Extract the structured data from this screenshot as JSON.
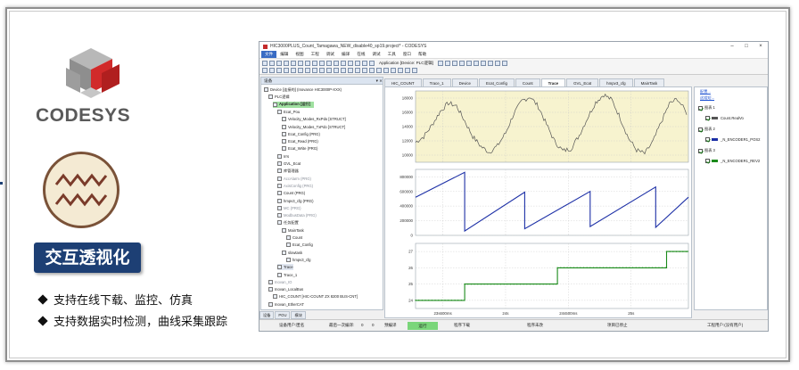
{
  "promo": {
    "logo_text": "CODESYS",
    "title": "交互透视化",
    "bullets": [
      "支持在线下载、监控、仿真",
      "支持数据实时检测，曲线采集跟踪"
    ],
    "colors": {
      "badge": "#1d3f74",
      "cube_red": "#d12a2a",
      "cube_gray": "#9a9a9a",
      "circle_fill": "#f4ead3",
      "zigzag": "#7a3b2a"
    }
  },
  "window": {
    "title": "HIC3000PLUS_Count_Tamagawa_NEW_disable40_sp19.project* - CODESYS",
    "controls": [
      "–",
      "□",
      "×"
    ],
    "menu": [
      "文件",
      "编辑",
      "视图",
      "工程",
      "调试",
      "编译",
      "在线",
      "调试",
      "工具",
      "窗口",
      "帮助"
    ],
    "toolbar_application": "Application [Device: PLC逻辑]"
  },
  "device_panel": {
    "title": "设备",
    "pin": "▾ ⨯",
    "items": [
      {
        "label": "Device [连接的] (Inovance HIC3000P-XXX)",
        "indent": 0,
        "style": "normal"
      },
      {
        "label": "PLC逻辑",
        "indent": 1,
        "style": "normal"
      },
      {
        "label": "Application [运行]",
        "indent": 2,
        "style": "sel"
      },
      {
        "label": "Ecat_Pou",
        "indent": 3,
        "style": "normal"
      },
      {
        "label": "Velocity_Modes_RxPdo [STRUCT]",
        "indent": 4,
        "style": "normal"
      },
      {
        "label": "Velocity_Modes_TxPdo [STRUCT]",
        "indent": 4,
        "style": "normal"
      },
      {
        "label": "Ecat_Config (PRG)",
        "indent": 4,
        "style": "normal"
      },
      {
        "label": "Ecat_Read (PRG)",
        "indent": 4,
        "style": "normal"
      },
      {
        "label": "Ecat_Write (PRG)",
        "indent": 4,
        "style": "normal"
      },
      {
        "label": "Irrs",
        "indent": 3,
        "style": "normal"
      },
      {
        "label": "GVL_Ecat",
        "indent": 3,
        "style": "normal"
      },
      {
        "label": "库管理器",
        "indent": 3,
        "style": "normal"
      },
      {
        "label": "AccAlarm (PRG)",
        "indent": 3,
        "style": "gray"
      },
      {
        "label": "AxisConfig (PRG)",
        "indent": 3,
        "style": "gray"
      },
      {
        "label": "Count (PRG)",
        "indent": 3,
        "style": "normal"
      },
      {
        "label": "hmpv3_cfg (PRG)",
        "indent": 3,
        "style": "normal"
      },
      {
        "label": "MC (PRG)",
        "indent": 3,
        "style": "gray"
      },
      {
        "label": "ModbusData (PRG)",
        "indent": 3,
        "style": "gray"
      },
      {
        "label": "任务配置",
        "indent": 3,
        "style": "normal"
      },
      {
        "label": "MainTask",
        "indent": 4,
        "style": "normal"
      },
      {
        "label": "Count",
        "indent": 5,
        "style": "normal"
      },
      {
        "label": "Ecat_Config",
        "indent": 5,
        "style": "normal"
      },
      {
        "label": "slowtask",
        "indent": 4,
        "style": "normal"
      },
      {
        "label": "hmpv3_cfg",
        "indent": 5,
        "style": "normal"
      },
      {
        "label": "Trace",
        "indent": 3,
        "style": "hl"
      },
      {
        "label": "Trace_1",
        "indent": 3,
        "style": "normal"
      },
      {
        "label": "Inovan_IO",
        "indent": 1,
        "style": "gray"
      },
      {
        "label": "Inovan_LocalBus",
        "indent": 1,
        "style": "normal"
      },
      {
        "label": "HIC_COUNT [HIC-COUNT ZX 8200 BUS-CNT]",
        "indent": 2,
        "style": "normal"
      },
      {
        "label": "Inovan_EtherCAT",
        "indent": 1,
        "style": "normal"
      }
    ]
  },
  "bottom_tabs": [
    "设备",
    "POU",
    "模块"
  ],
  "editor_tabs": [
    {
      "label": "HIC_COUNT",
      "active": false
    },
    {
      "label": "Trace_1",
      "active": false
    },
    {
      "label": "Device",
      "active": false
    },
    {
      "label": "Ecat_Config",
      "active": false
    },
    {
      "label": "Count",
      "active": false
    },
    {
      "label": "Trace",
      "active": true
    },
    {
      "label": "GVL_Ecat",
      "active": false
    },
    {
      "label": "hmpv3_cfg",
      "active": false
    },
    {
      "label": "MainTask",
      "active": false
    }
  ],
  "right_panel": {
    "links": [
      "配置...",
      "这组短..."
    ],
    "items": [
      {
        "label": "图表 1",
        "kind": "group"
      },
      {
        "label": "Count.RealVo",
        "kind": "series",
        "color": "#555555"
      },
      {
        "label": "图表 2",
        "kind": "group"
      },
      {
        "label": "_N_ENCODER1_POS2",
        "kind": "series",
        "color": "#1c2fa6"
      },
      {
        "label": "图表 3",
        "kind": "group"
      },
      {
        "label": "_N_ENCODER1_REV2",
        "kind": "series",
        "color": "#1a8a1a"
      }
    ]
  },
  "status": {
    "items": [
      "设备用户:匿名",
      "最后一次编译:",
      "0",
      "0",
      "预编译",
      "运行",
      "程序下载",
      "程序未改",
      "项目已停止",
      "工程用户:(没有用户)"
    ]
  },
  "chart_data": [
    {
      "type": "line",
      "title": "",
      "series": [
        {
          "name": "Count.RealVo",
          "color": "#555555"
        }
      ],
      "ylim": [
        9000,
        19000
      ],
      "y_ticks": [
        10000,
        12000,
        14000,
        16000,
        18000
      ],
      "x": [
        0,
        0.03,
        0.06,
        0.09,
        0.12,
        0.15,
        0.18,
        0.21,
        0.24,
        0.27,
        0.3,
        0.33,
        0.36,
        0.39,
        0.42,
        0.45,
        0.48,
        0.51,
        0.54,
        0.57,
        0.6,
        0.63,
        0.66,
        0.69,
        0.72,
        0.75,
        0.78,
        0.81,
        0.84,
        0.87,
        0.9,
        0.93,
        0.96,
        1.0
      ],
      "values": [
        11800,
        12600,
        14200,
        16100,
        17300,
        16900,
        14800,
        12600,
        11200,
        10400,
        11300,
        13100,
        15800,
        17600,
        18200,
        16800,
        14300,
        11900,
        10600,
        10900,
        12800,
        15200,
        17400,
        18500,
        17700,
        15200,
        12400,
        10700,
        10200,
        11900,
        14600,
        17200,
        17900,
        15500
      ],
      "grid": true,
      "background": "#f7f3cf"
    },
    {
      "type": "line",
      "title": "",
      "series": [
        {
          "name": "_N_ENCODER1_POS2",
          "color": "#1c2fa6"
        }
      ],
      "ylim": [
        0,
        900000
      ],
      "y_ticks": [
        0,
        200000,
        400000,
        600000,
        800000
      ],
      "x": [
        0,
        0.18,
        0.18,
        0.4,
        0.4,
        0.64,
        0.64,
        0.88,
        0.88,
        1.0
      ],
      "values": [
        520000,
        860000,
        60000,
        590000,
        90000,
        600000,
        120000,
        660000,
        110000,
        520000
      ],
      "grid": true,
      "background": "#ffffff"
    },
    {
      "type": "line",
      "title": "",
      "series": [
        {
          "name": "_N_ENCODER1_REV2",
          "color": "#1a8a1a"
        }
      ],
      "ylim": [
        23.5,
        27.5
      ],
      "y_ticks": [
        24,
        25,
        26,
        27
      ],
      "x": [
        0,
        0.18,
        0.18,
        0.52,
        0.52,
        0.92,
        0.92,
        1.0
      ],
      "values": [
        24,
        24,
        25,
        25,
        26,
        26,
        27,
        27
      ],
      "grid": true,
      "background": "#ffffff"
    }
  ],
  "x_axis_labels": [
    "23s600ms",
    "24s",
    "24s500ms",
    "25s"
  ]
}
